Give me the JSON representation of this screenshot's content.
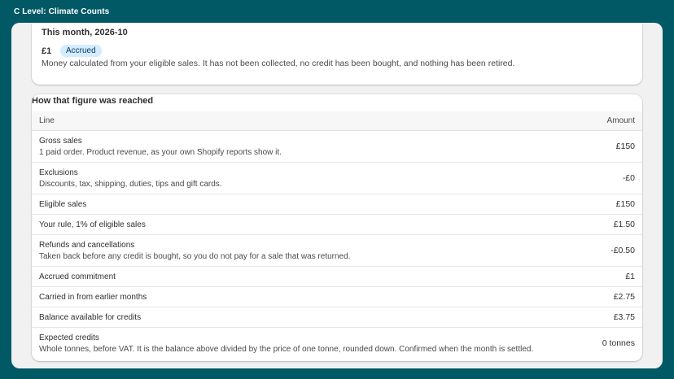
{
  "app": {
    "title": "C Level: Climate Counts"
  },
  "summary": {
    "heading": "This month, 2026-10",
    "amount": "£1",
    "status_badge": "Accrued",
    "description": "Money calculated from your eligible sales. It has not been collected, no credit has been bought, and nothing has been retired."
  },
  "breakdown": {
    "heading": "How that figure was reached",
    "columns": {
      "line": "Line",
      "amount": "Amount"
    },
    "rows": [
      {
        "title": "Gross sales",
        "description": "1 paid order. Product revenue, as your own Shopify reports show it.",
        "amount": "£150"
      },
      {
        "title": "Exclusions",
        "description": "Discounts, tax, shipping, duties, tips and gift cards.",
        "amount": "-£0"
      },
      {
        "title": "Eligible sales",
        "amount": "£150"
      },
      {
        "title": "Your rule, 1% of eligible sales",
        "amount": "£1.50"
      },
      {
        "title": "Refunds and cancellations",
        "description": "Taken back before any credit is bought, so you do not pay for a sale that was returned.",
        "amount": "-£0.50"
      },
      {
        "title": "Accrued commitment",
        "amount": "£1"
      },
      {
        "title": "Carried in from earlier months",
        "amount": "£2.75"
      },
      {
        "title": "Balance available for credits",
        "amount": "£3.75"
      },
      {
        "title": "Expected credits",
        "description": "Whole tonnes, before VAT. It is the balance above divided by the price of one tonne, rounded down. Confirmed when the month is settled.",
        "amount": "0 tonnes"
      }
    ]
  },
  "colors": {
    "app_background": "#025966",
    "badge_background": "#d5ebff",
    "panel_background": "#f1f1f1",
    "card_background": "#ffffff"
  }
}
